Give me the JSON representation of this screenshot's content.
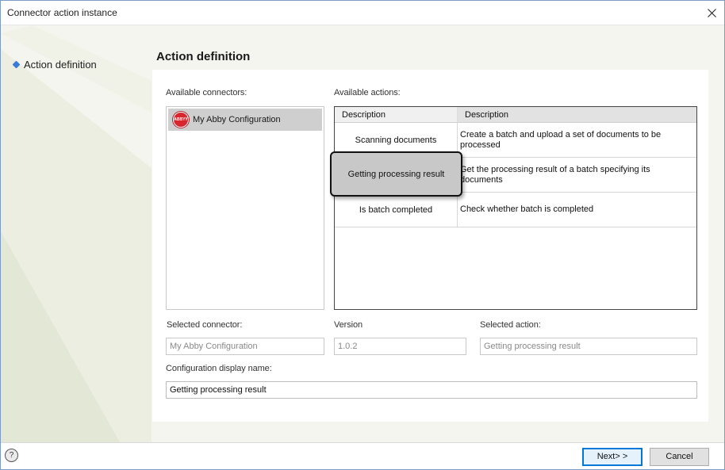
{
  "window": {
    "title": "Connector action instance"
  },
  "nav": {
    "items": [
      {
        "label": "Action definition"
      }
    ]
  },
  "section": {
    "title": "Action definition"
  },
  "connectors": {
    "label": "Available connectors:",
    "items": [
      {
        "logo_text": "ABBYY",
        "name": "My Abby Configuration",
        "selected": true
      }
    ]
  },
  "actions": {
    "label": "Available actions:",
    "columns": [
      "Description",
      "Description"
    ],
    "rows": [
      {
        "name": "Scanning documents",
        "description": "Create a batch and upload a set of documents to be processed"
      },
      {
        "name": "Getting processing result",
        "description": "Get the processing result of a batch specifying its documents",
        "selected": true
      },
      {
        "name": "Is batch completed",
        "description": "Check whether batch is completed"
      }
    ]
  },
  "form": {
    "selected_connector_label": "Selected connector:",
    "selected_connector_value": "My Abby Configuration",
    "version_label": "Version",
    "version_value": "1.0.2",
    "selected_action_label": "Selected action:",
    "selected_action_value": "Getting processing result",
    "display_name_label": "Configuration display name:",
    "display_name_value": "Getting processing result"
  },
  "footer": {
    "help_glyph": "?",
    "next_label": "Next> >",
    "cancel_label": "Cancel"
  },
  "colors": {
    "accent": "#0078d7",
    "nav_bullet": "#3a7bd5",
    "abbyy_red": "#d7262e",
    "selection_gray": "#cfcfcf"
  }
}
